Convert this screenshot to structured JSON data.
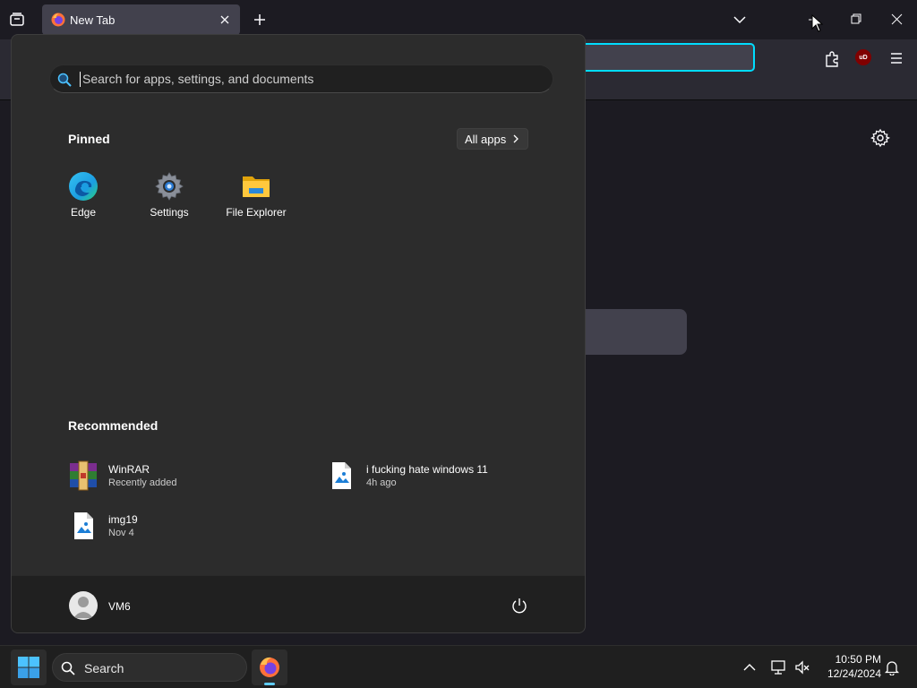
{
  "browser": {
    "tab": {
      "title": "New Tab"
    },
    "ublock_badge": "uD",
    "colors": {
      "accent": "#00ddff",
      "tab_bg": "#42414d",
      "toolbar_bg": "#2b2a33"
    }
  },
  "start_menu": {
    "search": {
      "placeholder": "Search for apps, settings, and documents",
      "value": ""
    },
    "pinned": {
      "title": "Pinned",
      "all_apps_label": "All apps",
      "apps": [
        {
          "label": "Edge",
          "icon": "edge-icon"
        },
        {
          "label": "Settings",
          "icon": "settings-gear-icon"
        },
        {
          "label": "File Explorer",
          "icon": "folder-icon"
        }
      ]
    },
    "recommended": {
      "title": "Recommended",
      "items": [
        {
          "name": "WinRAR",
          "subtitle": "Recently added",
          "icon": "winrar-icon"
        },
        {
          "name": "i fucking hate windows 11",
          "subtitle": "4h ago",
          "icon": "image-file-icon"
        },
        {
          "name": "img19",
          "subtitle": "Nov 4",
          "icon": "image-file-icon"
        }
      ]
    },
    "user": {
      "name": "VM6"
    }
  },
  "taskbar": {
    "search_label": "Search",
    "clock": {
      "time": "10:50 PM",
      "date": "12/24/2024"
    },
    "colors": {
      "running_indicator": "#60cdff"
    }
  }
}
